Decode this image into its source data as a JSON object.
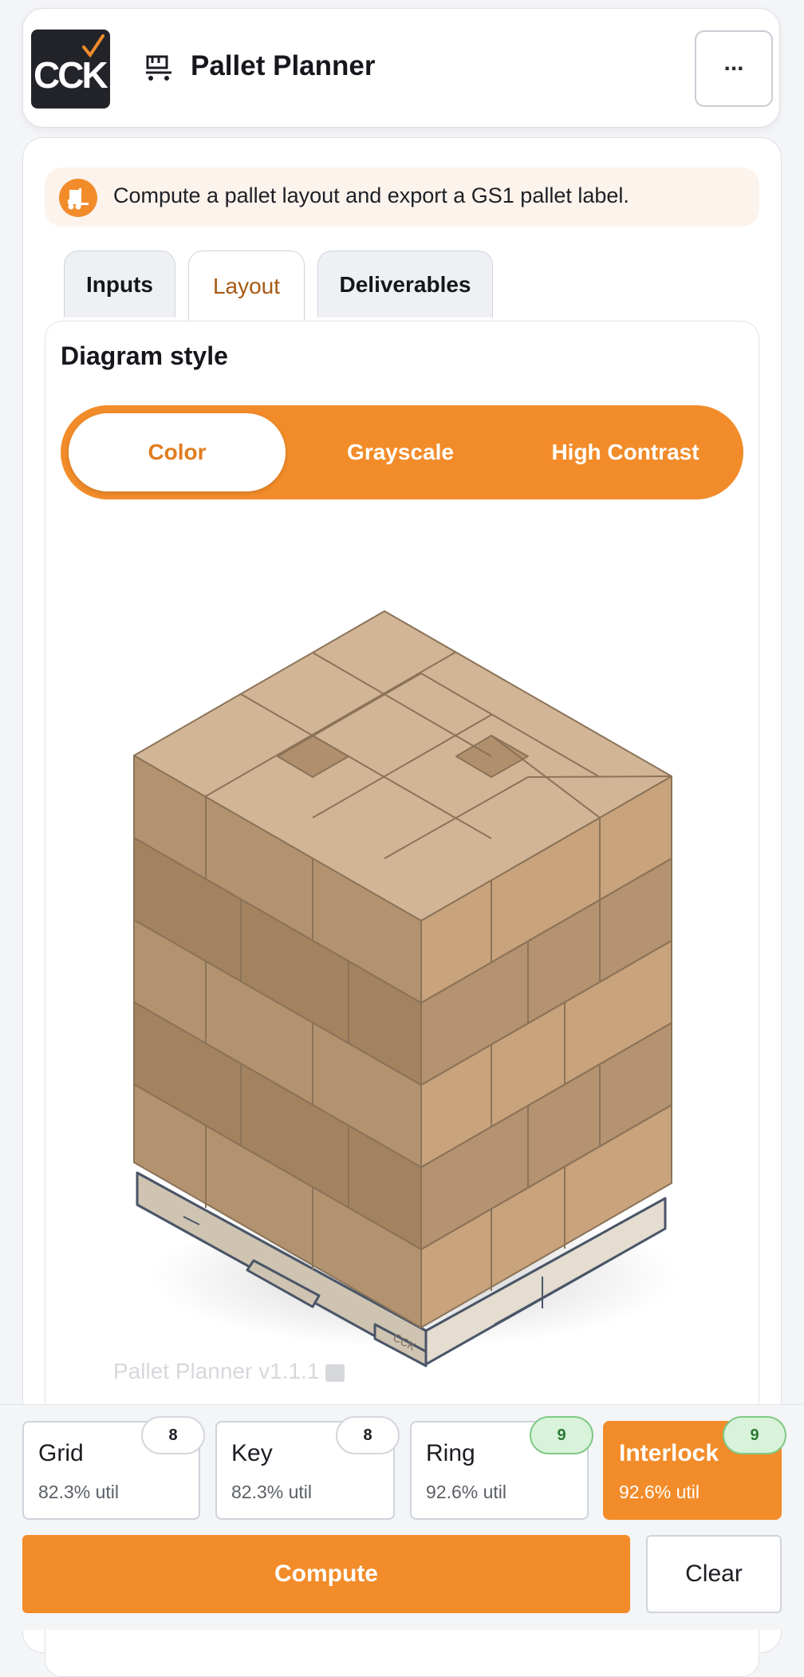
{
  "header": {
    "logo_text": "CCK",
    "title": "Pallet Planner",
    "menu_label": "..."
  },
  "banner": {
    "text": "Compute a pallet layout and export a GS1 pallet label."
  },
  "tabs": [
    {
      "label": "Inputs",
      "active": false
    },
    {
      "label": "Layout",
      "active": true
    },
    {
      "label": "Deliverables",
      "active": false
    }
  ],
  "layout": {
    "section_title": "Diagram style",
    "styles": [
      {
        "label": "Color",
        "selected": true
      },
      {
        "label": "Grayscale",
        "selected": false
      },
      {
        "label": "High Contrast",
        "selected": false
      }
    ],
    "watermark": "Pallet Planner v1.1.1",
    "pallet_logo_text": "CCK"
  },
  "patterns": [
    {
      "name": "Grid",
      "util": "82.3% util",
      "count": "8",
      "selected": false
    },
    {
      "name": "Key",
      "util": "82.3% util",
      "count": "8",
      "selected": false
    },
    {
      "name": "Ring",
      "util": "92.6% util",
      "count": "9",
      "selected": false
    },
    {
      "name": "Interlock",
      "util": "92.6% util",
      "count": "9",
      "selected": true
    }
  ],
  "actions": {
    "compute_label": "Compute",
    "clear_label": "Clear"
  },
  "colors": {
    "accent": "#f28c2a",
    "box_top": "#d2b597",
    "box_left": "#b3936f",
    "box_right": "#c9a37c",
    "pallet": "#e0d7c8",
    "pallet_outline": "#4a5568"
  }
}
